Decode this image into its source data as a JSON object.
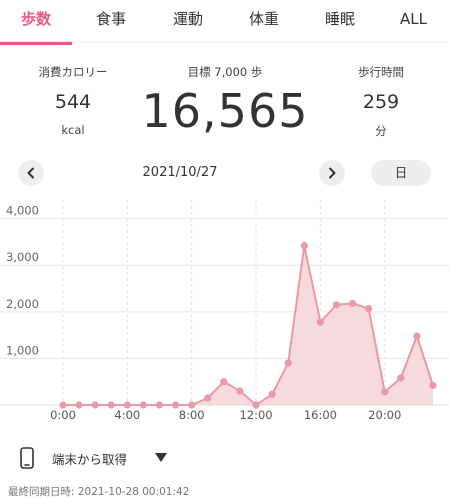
{
  "tabs": [
    {
      "label": "歩数",
      "active": true
    },
    {
      "label": "食事",
      "active": false
    },
    {
      "label": "運動",
      "active": false
    },
    {
      "label": "体重",
      "active": false
    },
    {
      "label": "睡眠",
      "active": false
    },
    {
      "label": "ALL",
      "active": false
    }
  ],
  "stats": {
    "calories": {
      "label": "消費カロリー",
      "value": "544",
      "unit": "kcal"
    },
    "goal_label": "目標 7,000 歩",
    "steps": "16,565",
    "walk_time": {
      "label": "歩行時間",
      "value": "259",
      "unit": "分"
    }
  },
  "nav": {
    "date": "2021/10/27",
    "period_button": "日",
    "prev_icon": "chevron-left-icon",
    "next_icon": "chevron-right-icon"
  },
  "chart_data": {
    "type": "area",
    "x": [
      0,
      1,
      2,
      3,
      4,
      5,
      6,
      7,
      8,
      9,
      10,
      11,
      12,
      13,
      14,
      15,
      16,
      17,
      18,
      19,
      20,
      21,
      22,
      23
    ],
    "values": [
      0,
      0,
      0,
      0,
      0,
      0,
      0,
      0,
      0,
      150,
      500,
      300,
      0,
      230,
      900,
      3420,
      1780,
      2150,
      2180,
      2070,
      280,
      580,
      1480,
      420
    ],
    "x_tick_labels": [
      "0:00",
      "4:00",
      "8:00",
      "12:00",
      "16:00",
      "20:00"
    ],
    "x_tick_positions": [
      0,
      4,
      8,
      12,
      16,
      20
    ],
    "y_ticks": [
      1000,
      2000,
      3000,
      4000
    ],
    "y_tick_labels": [
      "1,000",
      "2,000",
      "3,000",
      "4,000"
    ],
    "ylim": [
      0,
      4000
    ],
    "xlim": [
      0,
      23
    ],
    "grid": true,
    "color": "#e99aa6",
    "fill_color": "#f6d3d8"
  },
  "source": {
    "label": "端末から取得",
    "icon": "phone-icon",
    "caret_icon": "caret-down-icon"
  },
  "sync": {
    "text": "最終同期日時:  2021-10-28 00:01:42"
  }
}
